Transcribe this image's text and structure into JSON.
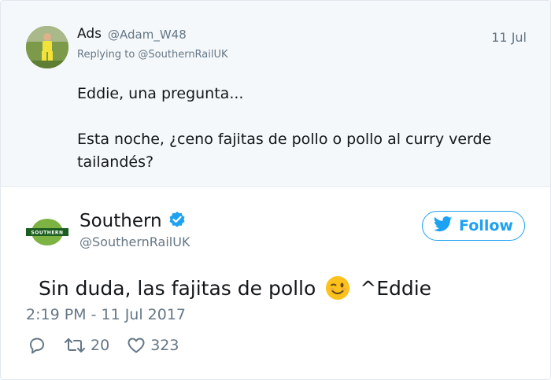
{
  "reply": {
    "name": "Ads",
    "handle": "@Adam_W48",
    "date": "11 Jul",
    "replying_to": "Replying to @SouthernRailUK",
    "text_line1": "Eddie, una pregunta...",
    "text_line2": "Esta noche, ¿ceno fajitas de pollo o  pollo al curry verde tailandés?"
  },
  "main": {
    "display_name": "Southern",
    "handle": "@SouthernRailUK",
    "logo_text": "SOUTHERN",
    "follow_label": "Follow",
    "text_before": "Sin duda, las fajitas de pollo",
    "text_after": " ^Eddie",
    "emoji": "winking-face-icon",
    "timestamp": "2:19 PM - 11 Jul 2017",
    "retweets": "20",
    "likes": "323"
  },
  "colors": {
    "accent": "#1da1f2",
    "muted": "#657786",
    "reply_background": "#f5f8fa",
    "brand_green": "#7cb342"
  }
}
